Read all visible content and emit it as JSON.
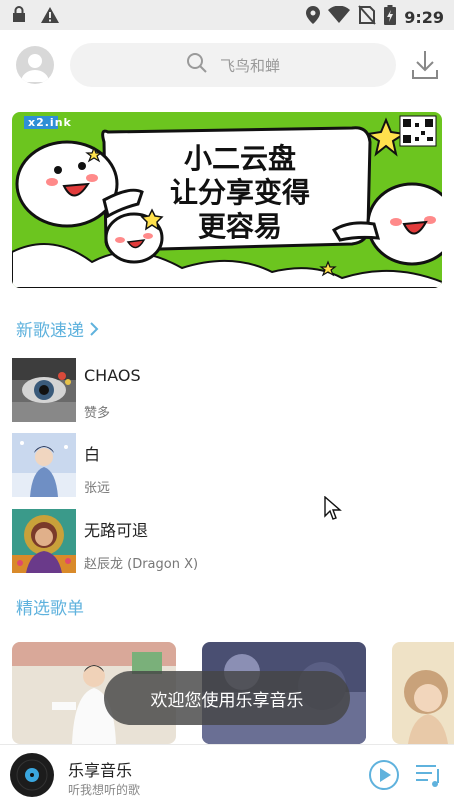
{
  "status_bar": {
    "time": "9:29",
    "icons": [
      "lock-icon",
      "warning-icon",
      "location-icon",
      "wifi-icon",
      "no-sim-icon",
      "battery-charging-icon"
    ]
  },
  "header": {
    "search_placeholder": "飞鸟和蝉",
    "icons": [
      "avatar",
      "search-icon",
      "download-icon"
    ]
  },
  "banner": {
    "brand": "x2.ink",
    "line1": "小二云盘",
    "line2": "让分享变得",
    "line3": "更容易"
  },
  "new_songs": {
    "title": "新歌速递",
    "items": [
      {
        "title": "CHAOS",
        "artist": "赞多"
      },
      {
        "title": "白",
        "artist": "张远"
      },
      {
        "title": "无路可退",
        "artist": "赵辰龙 (Dragon X)"
      }
    ]
  },
  "playlists": {
    "title": "精选歌单"
  },
  "toast": {
    "text": "欢迎您使用乐享音乐"
  },
  "player": {
    "title": "乐享音乐",
    "subtitle": "听我想听的歌",
    "icons": [
      "play-icon",
      "playlist-icon"
    ]
  },
  "colors": {
    "accent": "#5fb2dd",
    "banner_green": "#6cc51f"
  }
}
